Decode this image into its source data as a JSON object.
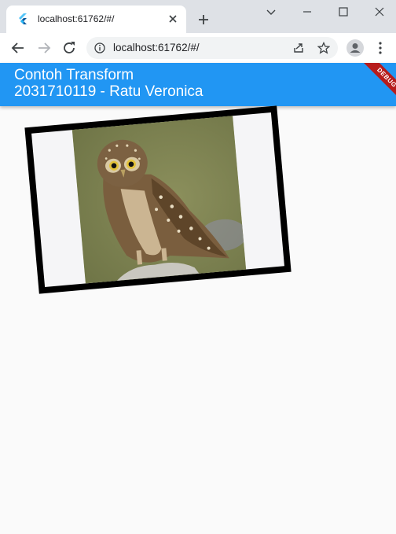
{
  "browser": {
    "tab_title": "localhost:61762/#/",
    "url": "localhost:61762/#/"
  },
  "app": {
    "title": "Contoh Transform",
    "subtitle": "2031710119 - Ratu Veronica",
    "debug_label": "DEBUG",
    "accent_color": "#2196f3"
  },
  "image": {
    "subject": "owl",
    "border_color": "#000000"
  }
}
